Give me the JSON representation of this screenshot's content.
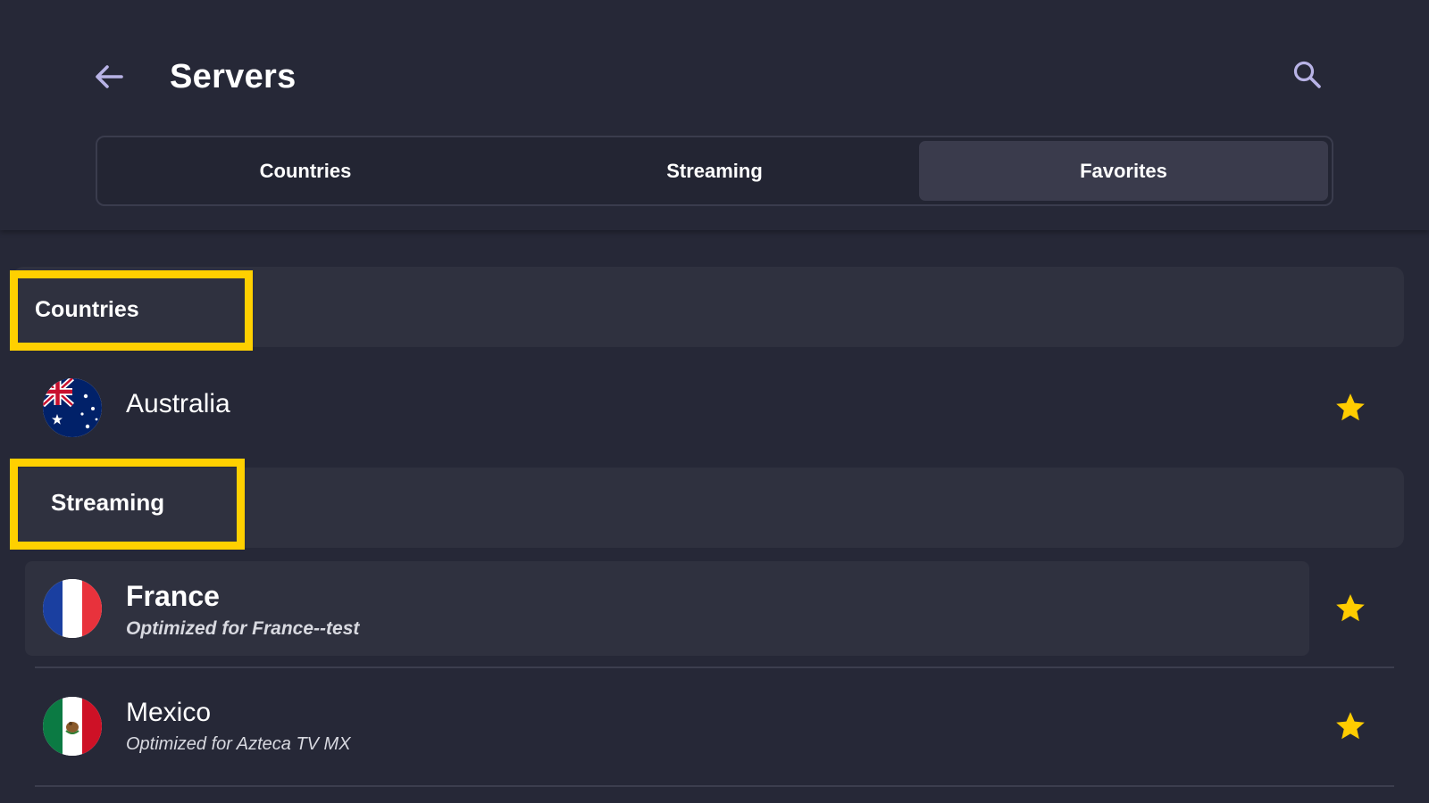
{
  "header": {
    "title": "Servers",
    "back_icon": "arrow-left-icon",
    "search_icon": "search-icon"
  },
  "tabs": [
    {
      "label": "Countries",
      "active": false
    },
    {
      "label": "Streaming",
      "active": false
    },
    {
      "label": "Favorites",
      "active": true
    }
  ],
  "sections": {
    "countries": {
      "label": "Countries",
      "items": [
        {
          "name": "Australia",
          "flag": "australia-flag-icon",
          "favorite": true
        }
      ]
    },
    "streaming": {
      "label": "Streaming",
      "items": [
        {
          "name": "France",
          "subtitle": "Optimized for France--test",
          "flag": "france-flag-icon",
          "favorite": true,
          "focused": true
        },
        {
          "name": "Mexico",
          "subtitle": "Optimized for Azteca TV MX",
          "flag": "mexico-flag-icon",
          "favorite": true
        }
      ]
    }
  },
  "colors": {
    "background": "#262837",
    "panel": "#2f313f",
    "highlight": "#ffd000",
    "star": "#ffcc00",
    "icon": "#b8b3e6"
  }
}
